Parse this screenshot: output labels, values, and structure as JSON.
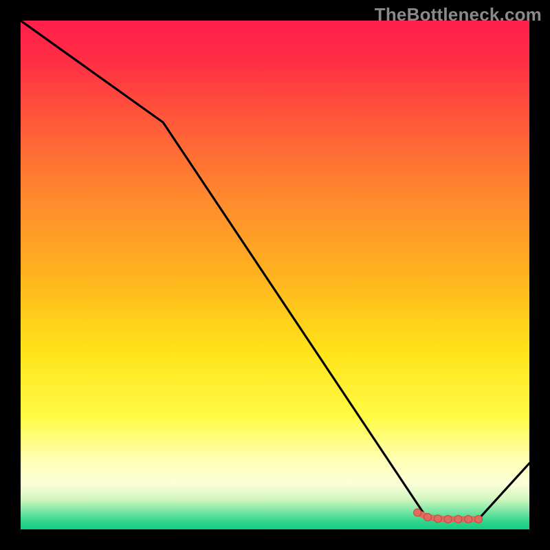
{
  "watermark": "TheBottleneck.com",
  "chart_data": {
    "type": "line",
    "title": "",
    "xlabel": "",
    "ylabel": "",
    "xlim": [
      0,
      100
    ],
    "ylim": [
      0,
      100
    ],
    "gradient_stops": [
      {
        "offset": 0.0,
        "color": "#ff1f4b"
      },
      {
        "offset": 0.08,
        "color": "#ff2e45"
      },
      {
        "offset": 0.2,
        "color": "#ff5a39"
      },
      {
        "offset": 0.35,
        "color": "#ff8a2e"
      },
      {
        "offset": 0.5,
        "color": "#ffb31f"
      },
      {
        "offset": 0.65,
        "color": "#ffe319"
      },
      {
        "offset": 0.78,
        "color": "#fffb47"
      },
      {
        "offset": 0.86,
        "color": "#ffffb0"
      },
      {
        "offset": 0.91,
        "color": "#fbffda"
      },
      {
        "offset": 0.94,
        "color": "#d4f7c0"
      },
      {
        "offset": 0.965,
        "color": "#78e6a4"
      },
      {
        "offset": 0.985,
        "color": "#2fd58c"
      },
      {
        "offset": 1.0,
        "color": "#15cd81"
      }
    ],
    "series": [
      {
        "name": "bottleneck-curve",
        "color": "#000000",
        "x": [
          0,
          28,
          80,
          90,
          100
        ],
        "y": [
          100,
          80,
          2,
          2,
          13
        ]
      }
    ],
    "markers": [
      {
        "name": "highlight-segment",
        "color": "#e06b5e",
        "stroke": "#c05040",
        "x": [
          78,
          80,
          82,
          84,
          86,
          88,
          90
        ],
        "y": [
          3.3,
          2.4,
          2.1,
          2.0,
          2.0,
          2.0,
          2.0
        ]
      }
    ]
  }
}
